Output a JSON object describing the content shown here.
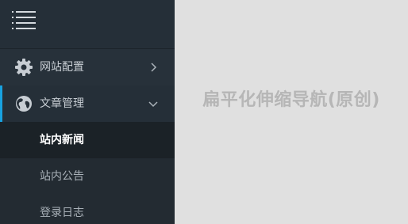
{
  "sidebar": {
    "toggle_icon": "hamburger-menu-icon",
    "items": [
      {
        "label": "网站配置",
        "icon": "gear-icon",
        "arrow": "chevron-right-icon",
        "expanded": false
      },
      {
        "label": "文章管理",
        "icon": "globe-icon",
        "arrow": "chevron-down-icon",
        "expanded": true,
        "children": [
          {
            "label": "站内新闻",
            "active": true
          },
          {
            "label": "站内公告",
            "active": false
          },
          {
            "label": "登录日志",
            "active": false
          }
        ]
      }
    ],
    "accent_color": "#18a2e0"
  },
  "main": {
    "title": "扁平化伸缩导航(原创)"
  }
}
